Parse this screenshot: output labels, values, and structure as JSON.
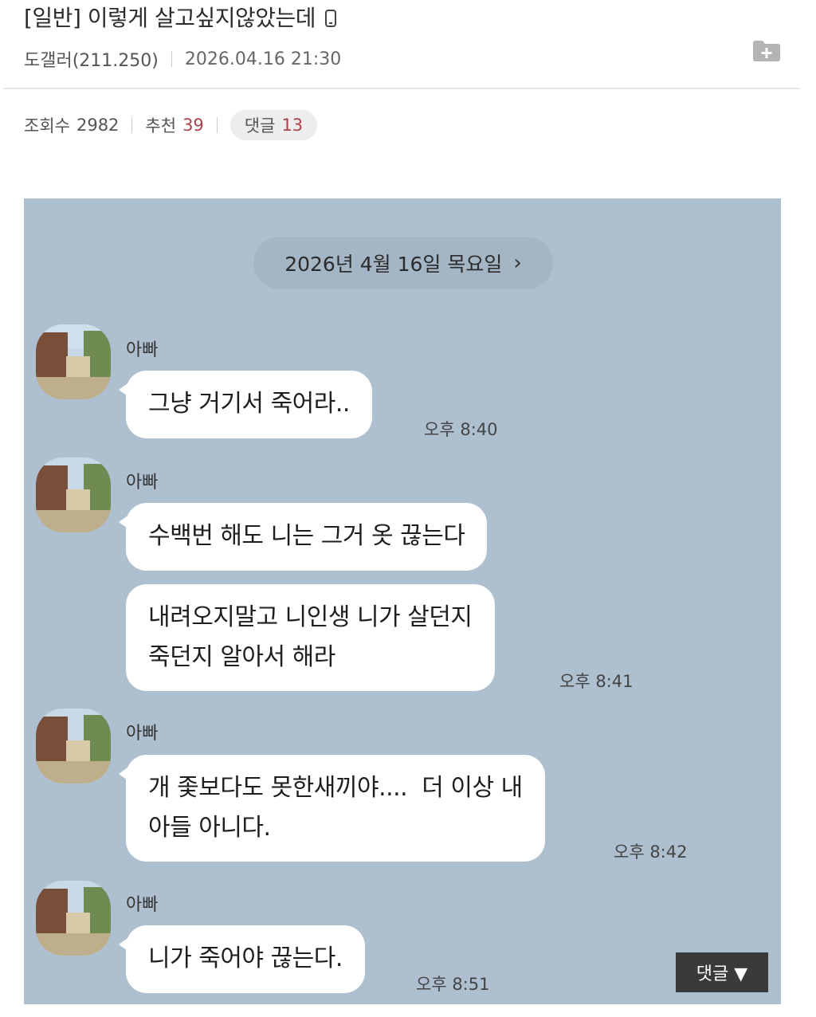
{
  "post": {
    "title": "[일반] 이렇게 살고싶지않았는데",
    "author": "도갤러(211.250)",
    "date": "2026.04.16 21:30",
    "views_label": "조회수",
    "views": "2982",
    "recommend_label": "추천",
    "recommend": "39",
    "comments_label": "댓글",
    "comments": "13"
  },
  "chat": {
    "date_label": "2026년 4월 16일 목요일",
    "date_chevron": "›",
    "messages": [
      {
        "sender": "아빠",
        "text": "그냥 거기서 죽어라..",
        "time": "오후 8:40"
      },
      {
        "sender": "아빠",
        "text": "수백번 해도 니는 그거 옷 끊는다",
        "time": ""
      },
      {
        "sender": "",
        "text": "내려오지말고 니인생 니가 살던지\n죽던지 알아서 해라",
        "time": "오후 8:41"
      },
      {
        "sender": "아빠",
        "text": "개 좇보다도 못한새끼야....  더 이상 내\n아들 아니다.",
        "time": "오후 8:42"
      },
      {
        "sender": "아빠",
        "text": "니가 죽어야 끊는다.",
        "time": "오후 8:51"
      }
    ]
  },
  "comment_button": {
    "label": "댓글 ▼"
  },
  "icons": [
    "mobile-icon",
    "folder-add-icon",
    "chevron-right-icon",
    "avatar"
  ],
  "colors": {
    "chat_bg": "#aebfd0",
    "bubble": "#ffffff",
    "accent_red": "#a8434a",
    "button_dark": "#3a3a3a"
  }
}
